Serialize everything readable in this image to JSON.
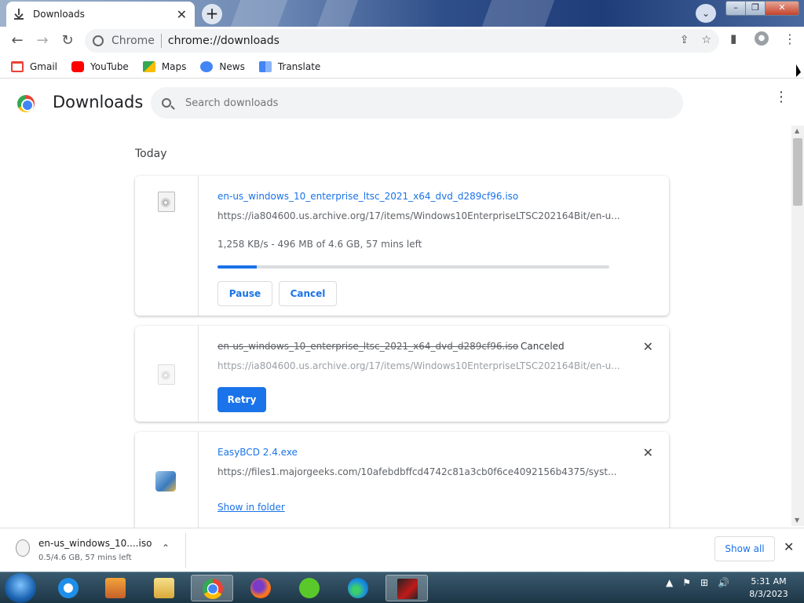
{
  "window": {
    "tab_title": "Downloads",
    "tab_close": "✕",
    "new_tab": "+",
    "tab_search": "⌄",
    "min": "–",
    "max": "❐",
    "close": "✕"
  },
  "toolbar": {
    "back": "←",
    "forward": "→",
    "reload": "↻",
    "site_label": "Chrome",
    "url": "chrome://downloads",
    "share": "⇪",
    "star": "☆",
    "sidepanel": "▮",
    "profile": "●",
    "menu": "⋮"
  },
  "bookmarks": [
    {
      "label": "Gmail",
      "icon": "gmail-icon",
      "color": "#ea4335"
    },
    {
      "label": "YouTube",
      "icon": "youtube-icon",
      "color": "#ff0000"
    },
    {
      "label": "Maps",
      "icon": "maps-icon",
      "color": "#34a853"
    },
    {
      "label": "News",
      "icon": "news-icon",
      "color": "#4285f4"
    },
    {
      "label": "Translate",
      "icon": "translate-icon",
      "color": "#4285f4"
    }
  ],
  "header": {
    "title": "Downloads",
    "search_placeholder": "Search downloads",
    "menu": "⋮"
  },
  "section_label": "Today",
  "downloads": [
    {
      "name": "en-us_windows_10_enterprise_ltsc_2021_x64_dvd_d289cf96.iso",
      "url": "https://ia804600.us.archive.org/17/items/Windows10EnterpriseLTSC202164Bit/en-u...",
      "status": "1,258 KB/s - 496 MB of 4.6 GB, 57 mins left",
      "progress": 0.1,
      "actions": [
        "Pause",
        "Cancel"
      ]
    },
    {
      "name": "en-us_windows_10_enterprise_ltsc_2021_x64_dvd_d289cf96.iso",
      "url": "https://ia804600.us.archive.org/17/items/Windows10EnterpriseLTSC202164Bit/en-u...",
      "state": "Canceled",
      "actions": [
        "Retry"
      ],
      "remove": "✕"
    },
    {
      "name": "EasyBCD 2.4.exe",
      "url": "https://files1.majorgeeks.com/10afebdbffcd4742c81a3cb0f6ce4092156b4375/syst...",
      "actions": [
        "Show in folder"
      ],
      "remove": "✕"
    }
  ],
  "shelf": {
    "file_name": "en-us_windows_10....iso",
    "status": "0.5/4.6 GB, 57 mins left",
    "chevron": "⌃",
    "show_all": "Show all",
    "close": "✕"
  },
  "taskbar": {
    "time": "5:31 AM",
    "date": "8/3/2023",
    "tray": [
      "▲",
      "⚑",
      "⊞",
      "🔊"
    ]
  }
}
